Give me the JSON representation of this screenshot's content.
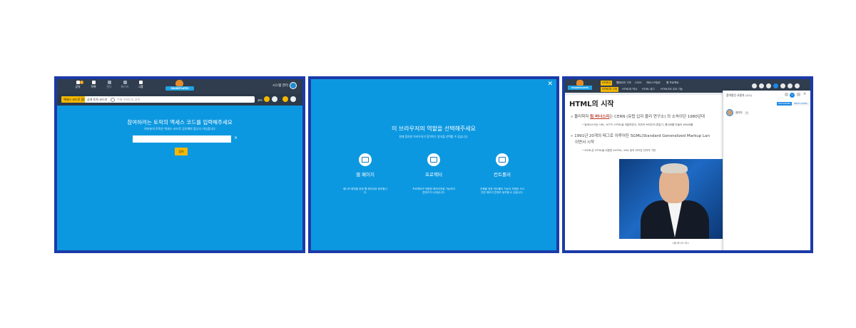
{
  "colors": {
    "frame": "#1b3aa8",
    "panel_bg": "#0c98e0",
    "toolbar": "#2f3d4e",
    "accent": "#f5b800"
  },
  "panel1": {
    "nav": [
      {
        "label": "공유",
        "icon": "share-icon"
      },
      {
        "label": "목록",
        "icon": "list-icon"
      },
      {
        "label": "열다",
        "icon": "open-icon"
      },
      {
        "label": "패키지",
        "icon": "package-icon"
      },
      {
        "label": "그룹",
        "icon": "group-icon"
      }
    ],
    "nav_badge": "1",
    "logo_text": "SHAREPLATES",
    "user_label": "시스템 관리",
    "chip_yellow": "액세스 코드로 참여",
    "chip_white": "공개 토픽 코드로",
    "search_placeholder": "주제 키워드로 검색",
    "search_label": "코드",
    "heading": "참여하려는 토픽의 액세스 코드를 입력해주세요",
    "subheading": "여러분의 토픽은 액세스 코드로 공유해야 합니다 가능합니다",
    "input_value": "",
    "clear_symbol": "×",
    "submit_label": "참여"
  },
  "panel2": {
    "close_symbol": "✕",
    "title": "이 브라우저의 역할을 선택해주세요",
    "subtitle": "현재 접속한 브라우저가 동작하는 방식을 선택할 수 있습니다.",
    "options": [
      {
        "label": "웹 페이지",
        "desc": "페니의 화면을 위한 웹 페이지로 동작합니다.",
        "icon": "browser-icon"
      },
      {
        "label": "프로젝터",
        "desc": "프로젝터의 적합한 레이아웃을 가능하여 콘텐츠가 나타납니다.",
        "icon": "projector-icon"
      },
      {
        "label": "컨트롤러",
        "desc": "진행을 위한 컨트롤러 기능이 지원된 크고 관련 레이어 콘텐츠 동작할 수 있습니다.",
        "icon": "gamepad-icon"
      }
    ]
  },
  "panel3": {
    "logo_text": "SHAREPLATES",
    "top_tabs": [
      "HTML5",
      "웹페이지 기초",
      "CSS3",
      "자바스크립트",
      "웹 프로젝트"
    ],
    "sub_tabs": [
      "HTML의 시작",
      "HTML의 역사",
      "HTML 태그",
      "HTML5의 주요 기능"
    ],
    "title": "HTML의 시작",
    "bullet1_pre": "물리학자 ",
    "bullet1_link": "팀 버너스리",
    "bullet1_post": "는 CERN (유럽 입자 물리 연구소) 의 소속이던 1980년대",
    "bullet1_sub": "팀버너스리는 URL, HTTP, HTML을 개발하였고, 최초의 브라우저 편집기, 웹서버를 만들어 WWW를",
    "bullet2_line1": "1991년 20개의 태그로 이루어진 SGML(Standard Generalized Markup Lan",
    "bullet2_line2": "이면서 시작",
    "bullet2_sub": "SGML은 HTML을 비롯한 XHTML, XML 등의 마크업 언어의 기반",
    "caption": "<팀 버너스 리>",
    "side_title": "참여중인 사용자 (1/1)",
    "side_count": "1",
    "pill_on": "RECORDING",
    "pill_off": "INPUT USERS",
    "user_name": "참여자",
    "user_badge": "나"
  }
}
